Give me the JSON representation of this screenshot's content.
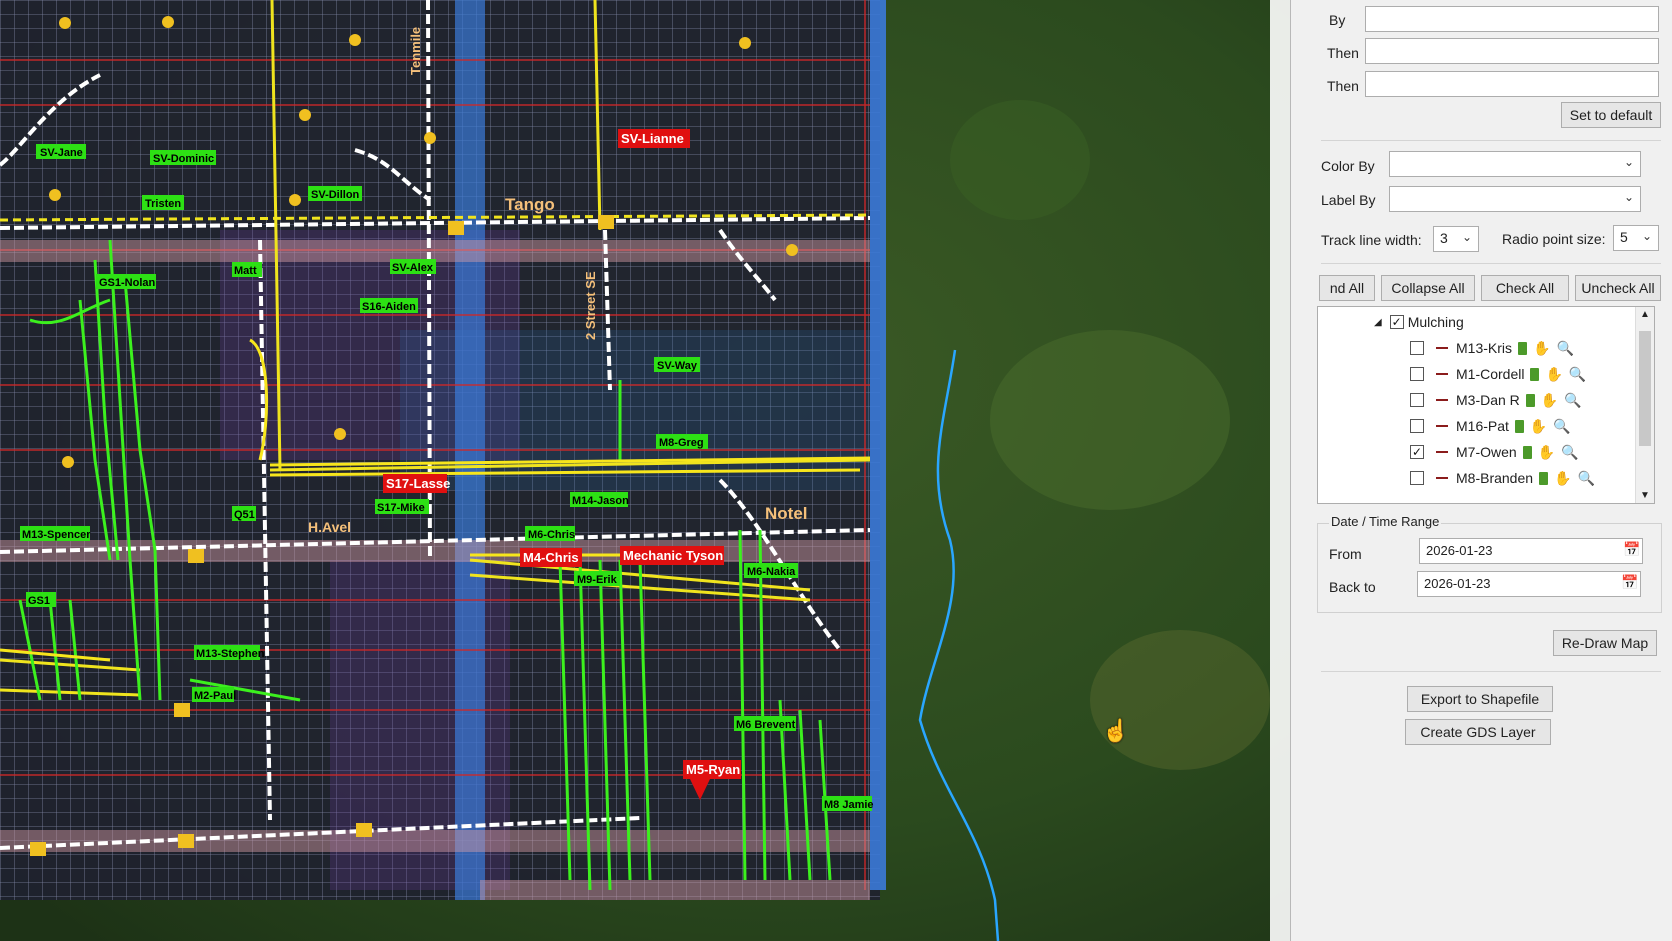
{
  "map": {
    "labels_green": [
      "SV-Jane",
      "SV-Dominic",
      "Tristen",
      "SV-Dillon",
      "Matt",
      "SV-Alex",
      "S16-Aiden",
      "GS1-Nolan",
      "SV-Way",
      "M8-Greg",
      "M14-Jason",
      "M6-Chris",
      "M9-Erik",
      "M6-Nakia",
      "Q51",
      "M13-Spencer",
      "GS1",
      "M13-Stephen",
      "M2-Paul",
      "S17-Mike",
      "M6 Brevent",
      "M8 Jamie"
    ],
    "labels_red": [
      "SV-Lianne",
      "S17-Lasse",
      "M4-Chris",
      "Mechanic Tyson",
      "M5-Ryan"
    ],
    "road_labels": [
      "Tango",
      "Notel",
      "H.Avel",
      "2 Street SE",
      "Tenmile"
    ],
    "colors": {
      "grid": "#9aa0c4",
      "track": "#3cf01e",
      "road": "#ffffff",
      "highlight": "#f0e41e",
      "water": "#2aa6ff",
      "label_red": "#e01010",
      "label_green": "#2de014"
    }
  },
  "panel": {
    "sort": {
      "by_label": "By",
      "then1_label": "Then",
      "then2_label": "Then",
      "by_value": "",
      "then1_value": "",
      "then2_value": "",
      "default_button": "Set to default"
    },
    "color_by_label": "Color By",
    "color_by_value": "",
    "label_by_label": "Label By",
    "label_by_value": "",
    "track_width_label": "Track line width:",
    "track_width_value": "3",
    "radio_size_label": "Radio point size:",
    "radio_size_value": "5",
    "tree_buttons": {
      "expand": "nd All",
      "collapse": "Collapse All",
      "check": "Check All",
      "uncheck": "Uncheck All"
    },
    "tree": {
      "group_label": "Mulching",
      "group_checked": true,
      "items": [
        {
          "label": "M13-Kris",
          "checked": false
        },
        {
          "label": "M1-Cordell",
          "checked": false
        },
        {
          "label": "M3-Dan R",
          "checked": false
        },
        {
          "label": "M16-Pat",
          "checked": false
        },
        {
          "label": "M7-Owen",
          "checked": true
        },
        {
          "label": "M8-Branden",
          "checked": false
        }
      ]
    },
    "date_range": {
      "title": "Date / Time Range",
      "from_label": "From",
      "from_value": "2026-01-23",
      "back_label": "Back to",
      "back_value": "2026-01-23"
    },
    "redraw_button": "Re-Draw Map",
    "export_button": "Export to Shapefile",
    "gds_button": "Create GDS Layer"
  }
}
